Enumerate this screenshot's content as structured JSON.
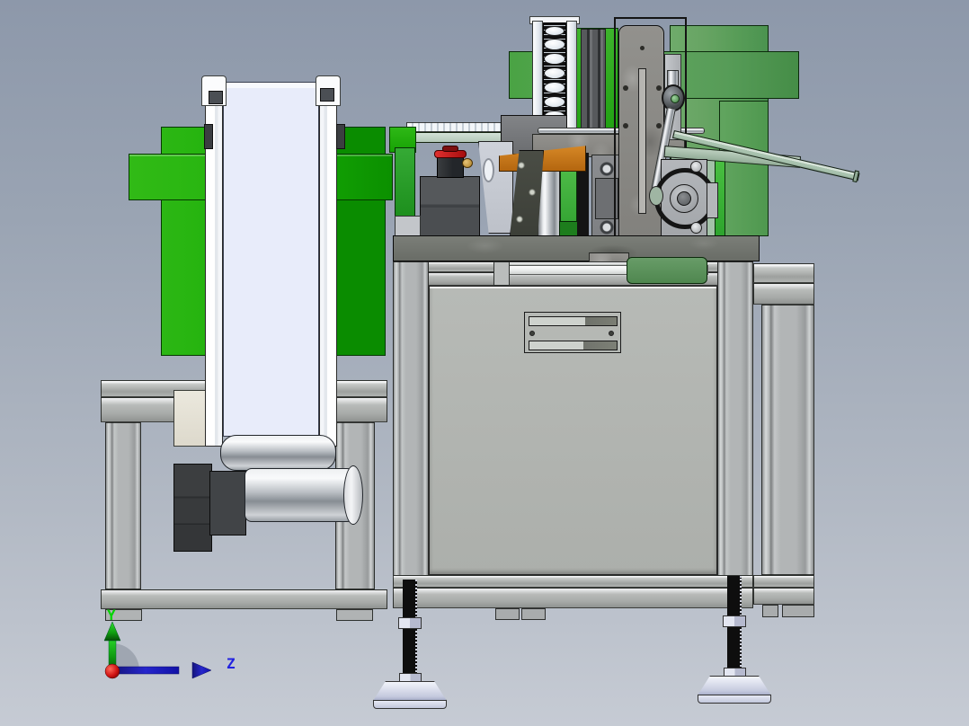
{
  "viewport": {
    "type": "3d-cad-viewport",
    "view_orientation": "front",
    "background_top": "#8d98aa",
    "background_bottom": "#c6cbd4"
  },
  "orientation_triad": {
    "y_axis_label": "Y",
    "z_axis_label": "Z",
    "y_axis_color": "#00c800",
    "z_axis_color": "#2020d0",
    "origin_color": "#cf1212"
  },
  "model": {
    "components": [
      "left-bowl-feeder",
      "left-feeder-ring",
      "vertical-belt-conveyor",
      "conveyor-stand",
      "conveyor-drive-motor",
      "gearbox",
      "right-bowl-feeder",
      "right-feeder-ring",
      "linear-feed-track",
      "vertical-part-rail",
      "escapement-plate",
      "rod-end-bearing",
      "cam-crank-mechanism",
      "guide-bar",
      "emergency-stop-button",
      "machine-table",
      "extrusion-frame",
      "door-panel",
      "vent-slot-plate",
      "side-extension-frame",
      "leveling-foot-left",
      "leveling-foot-right"
    ]
  },
  "colors": {
    "feeder_green_bright": "#1fb30a",
    "feeder_green_dark": "#0a8c00",
    "machine_green": "#5ea45e",
    "sage_panel": "#a3c2a8",
    "guide_bar_sage": "#a8c2ae",
    "frame_gray": "#b4b7b8",
    "door_gray": "#b1b4b0",
    "table_gray": "#70736f",
    "belt_white": "#e8ecfa",
    "estop_red": "#c11212",
    "orange_bracket": "#c2731c",
    "foot_black": "#0e0e0e",
    "foot_base_lavender": "#d7daea"
  }
}
